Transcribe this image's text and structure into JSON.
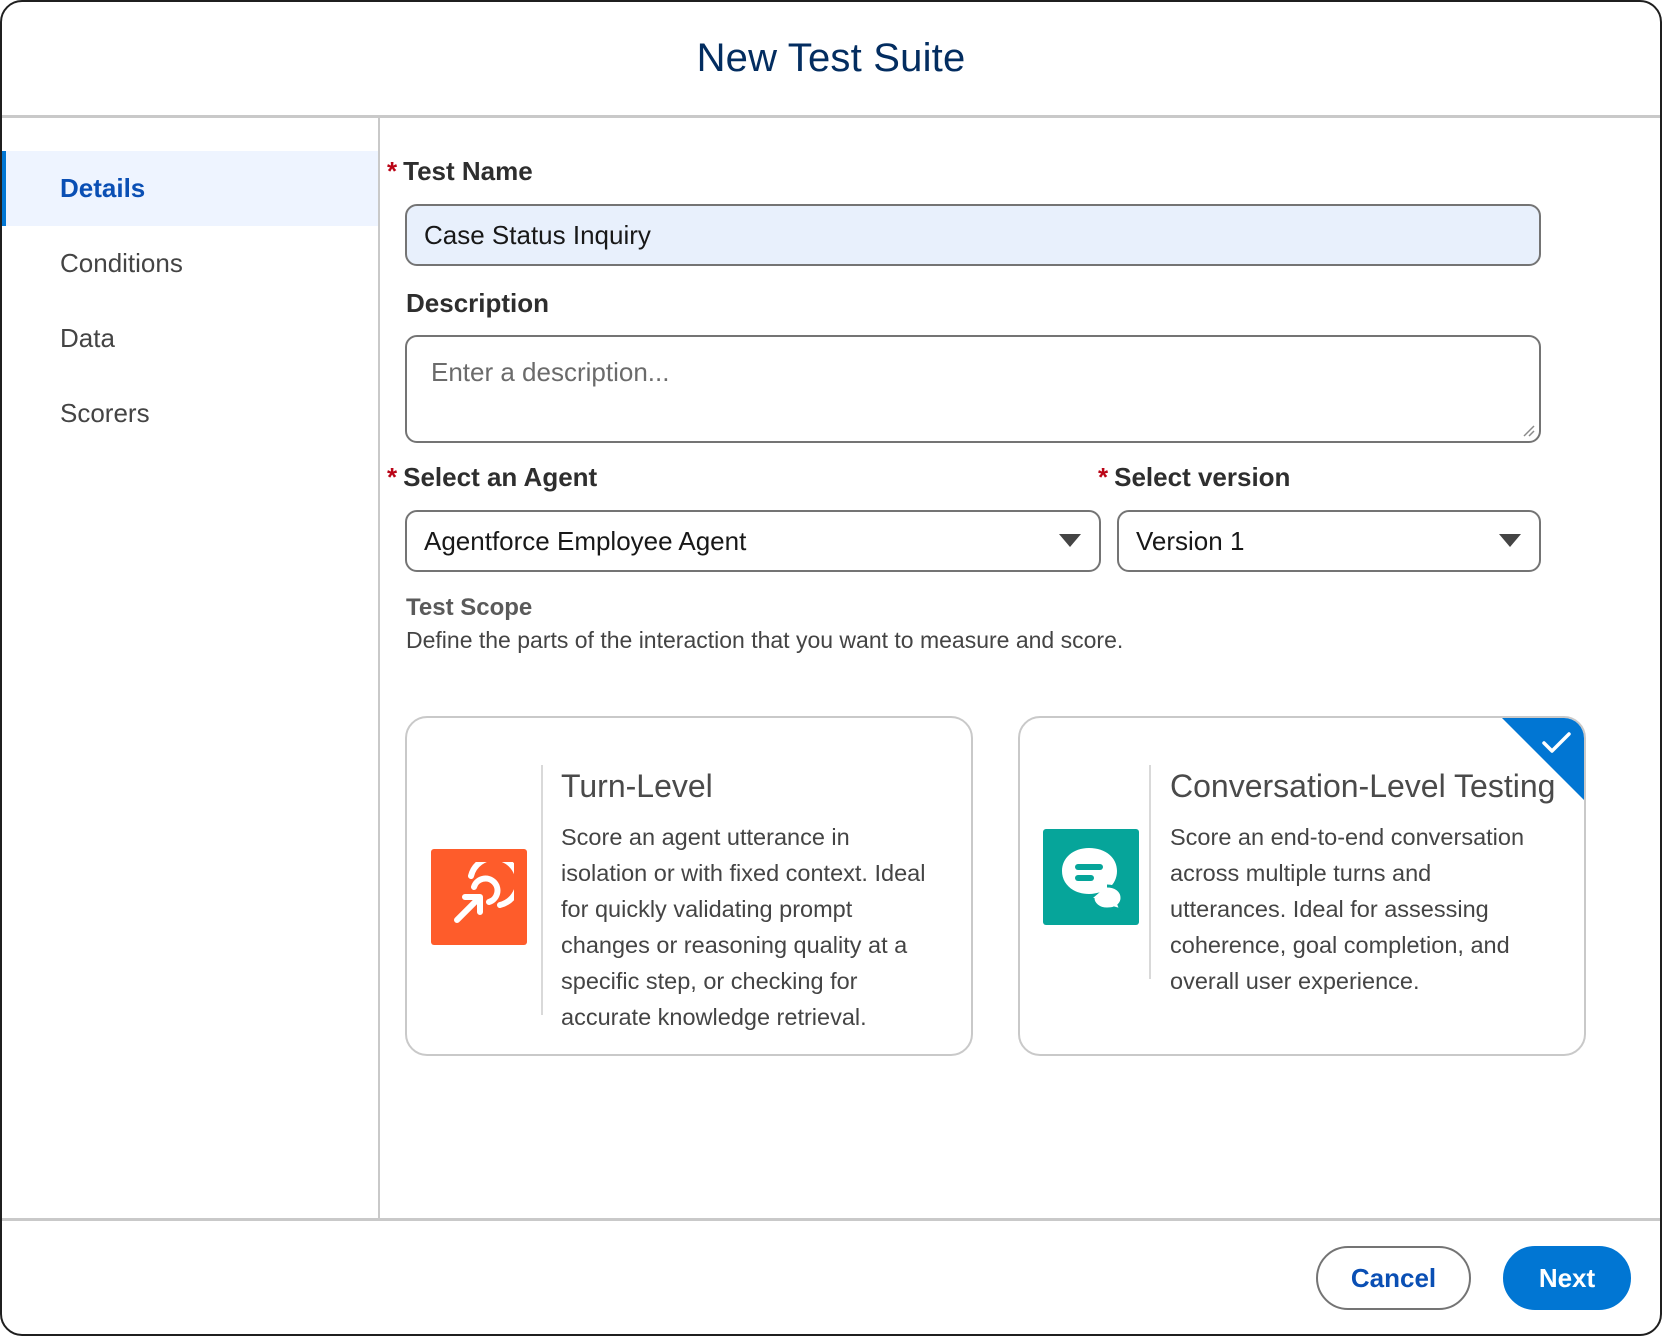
{
  "modal": {
    "title": "New Test Suite"
  },
  "sidebar": {
    "items": [
      {
        "label": "Details",
        "active": true
      },
      {
        "label": "Conditions",
        "active": false
      },
      {
        "label": "Data",
        "active": false
      },
      {
        "label": "Scorers",
        "active": false
      }
    ]
  },
  "form": {
    "required_marker": "*",
    "test_name": {
      "label": "Test Name",
      "value": "Case Status Inquiry"
    },
    "description": {
      "label": "Description",
      "placeholder": "Enter a description..."
    },
    "agent": {
      "label": "Select an Agent",
      "value": "Agentforce Employee Agent"
    },
    "version": {
      "label": "Select version",
      "value": "Version 1"
    }
  },
  "scope": {
    "title": "Test Scope",
    "description": "Define the parts of the interaction that you want to measure and score.",
    "cards": [
      {
        "title": "Turn-Level",
        "lines": [
          "Score an agent utterance in",
          "isolation or with fixed context. Ideal",
          "for quickly validating prompt",
          "changes or reasoning quality at a",
          "specific step, or checking for",
          "accurate knowledge retrieval."
        ],
        "icon": "turn-level-target-arrow-icon",
        "icon_color": "#fe5c2b",
        "selected": false
      },
      {
        "title": "Conversation-Level Testing",
        "lines": [
          "Score an end-to-end conversation",
          "across multiple turns and",
          "utterances. Ideal for assessing",
          "coherence, goal completion, and",
          "overall user experience."
        ],
        "icon": "conversation-bubbles-icon",
        "icon_color": "#06a59a",
        "selected": true
      }
    ]
  },
  "footer": {
    "cancel_label": "Cancel",
    "next_label": "Next"
  },
  "colors": {
    "brand": "#0176d3",
    "title": "#032d60",
    "required": "#ba0517"
  }
}
